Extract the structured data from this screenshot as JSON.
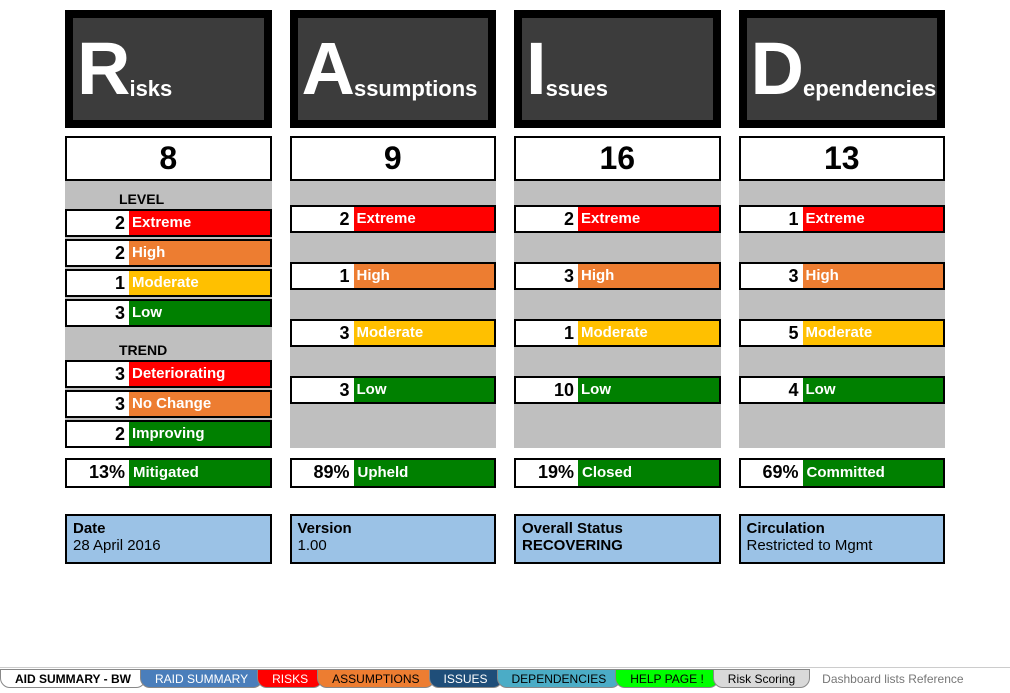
{
  "headers": {
    "risks": {
      "big": "R",
      "rest": "isks"
    },
    "assumptions": {
      "big": "A",
      "rest": "ssumptions"
    },
    "issues": {
      "big": "I",
      "rest": "ssues"
    },
    "dependencies": {
      "big": "D",
      "rest": "ependencies"
    }
  },
  "totals": {
    "risks": "8",
    "assumptions": "9",
    "issues": "16",
    "dependencies": "13"
  },
  "section_labels": {
    "level": "LEVEL",
    "trend": "TREND"
  },
  "risks": {
    "level": [
      {
        "count": "2",
        "label": "Extreme",
        "color": "red"
      },
      {
        "count": "2",
        "label": "High",
        "color": "orange"
      },
      {
        "count": "1",
        "label": "Moderate",
        "color": "yellow"
      },
      {
        "count": "3",
        "label": "Low",
        "color": "green"
      }
    ],
    "trend": [
      {
        "count": "3",
        "label": "Deteriorating",
        "color": "red"
      },
      {
        "count": "3",
        "label": "No Change",
        "color": "orange"
      },
      {
        "count": "2",
        "label": "Improving",
        "color": "green"
      }
    ],
    "summary": {
      "pct": "13%",
      "label": "Mitigated"
    }
  },
  "assumptions": {
    "level": [
      {
        "count": "2",
        "label": "Extreme",
        "color": "red"
      },
      {
        "count": "1",
        "label": "High",
        "color": "orange"
      },
      {
        "count": "3",
        "label": "Moderate",
        "color": "yellow"
      },
      {
        "count": "3",
        "label": "Low",
        "color": "green"
      }
    ],
    "summary": {
      "pct": "89%",
      "label": "Upheld"
    }
  },
  "issues": {
    "level": [
      {
        "count": "2",
        "label": "Extreme",
        "color": "red"
      },
      {
        "count": "3",
        "label": "High",
        "color": "orange"
      },
      {
        "count": "1",
        "label": "Moderate",
        "color": "yellow"
      },
      {
        "count": "10",
        "label": "Low",
        "color": "green"
      }
    ],
    "summary": {
      "pct": "19%",
      "label": "Closed"
    }
  },
  "dependencies": {
    "level": [
      {
        "count": "1",
        "label": "Extreme",
        "color": "red"
      },
      {
        "count": "3",
        "label": "High",
        "color": "orange"
      },
      {
        "count": "5",
        "label": "Moderate",
        "color": "yellow"
      },
      {
        "count": "4",
        "label": "Low",
        "color": "green"
      }
    ],
    "summary": {
      "pct": "69%",
      "label": "Committed"
    }
  },
  "info": {
    "date": {
      "k": "Date",
      "v": "28 April 2016"
    },
    "version": {
      "k": "Version",
      "v": "1.00"
    },
    "status": {
      "k": "Overall Status",
      "v": "RECOVERING"
    },
    "circ": {
      "k": "Circulation",
      "v": "Restricted to Mgmt"
    }
  },
  "tabs": {
    "t0": "AID SUMMARY - BW",
    "t1": "RAID SUMMARY",
    "t2": "RISKS",
    "t3": "ASSUMPTIONS",
    "t4": "ISSUES",
    "t5": "DEPENDENCIES",
    "t6": "HELP PAGE !",
    "t7": "Risk Scoring",
    "tail": "Dashboard lists Reference"
  }
}
